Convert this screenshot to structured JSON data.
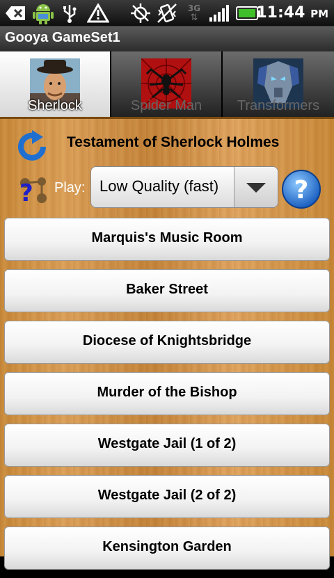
{
  "status_bar": {
    "time": "11:44",
    "ampm": "PM",
    "network_label": "3G",
    "icons": [
      "usb-debug-icon",
      "android-icon",
      "usb-icon",
      "warning-icon",
      "gps-icon",
      "vibrate-icon",
      "network-3g-icon",
      "signal-icon",
      "battery-icon"
    ]
  },
  "app": {
    "title": "Gooya GameSet1"
  },
  "tabs": [
    {
      "label": "Sherlock",
      "selected": true
    },
    {
      "label": "Spider Man",
      "selected": false
    },
    {
      "label": "Transformers",
      "selected": false
    }
  ],
  "header": {
    "game_title": "Testament of Sherlock Holmes",
    "play_label": "Play:",
    "quality_value": "Low Quality (fast)"
  },
  "levels": [
    "Marquis's Music Room",
    "Baker Street",
    "Diocese of Knightsbridge",
    "Murder of the Bishop",
    "Westgate Jail (1 of 2)",
    "Westgate Jail (2 of 2)",
    "Kensington Garden"
  ],
  "colors": {
    "wood": "#d49a52",
    "help_blue": "#2a7fd8",
    "tab_selected": "#ffffff"
  }
}
